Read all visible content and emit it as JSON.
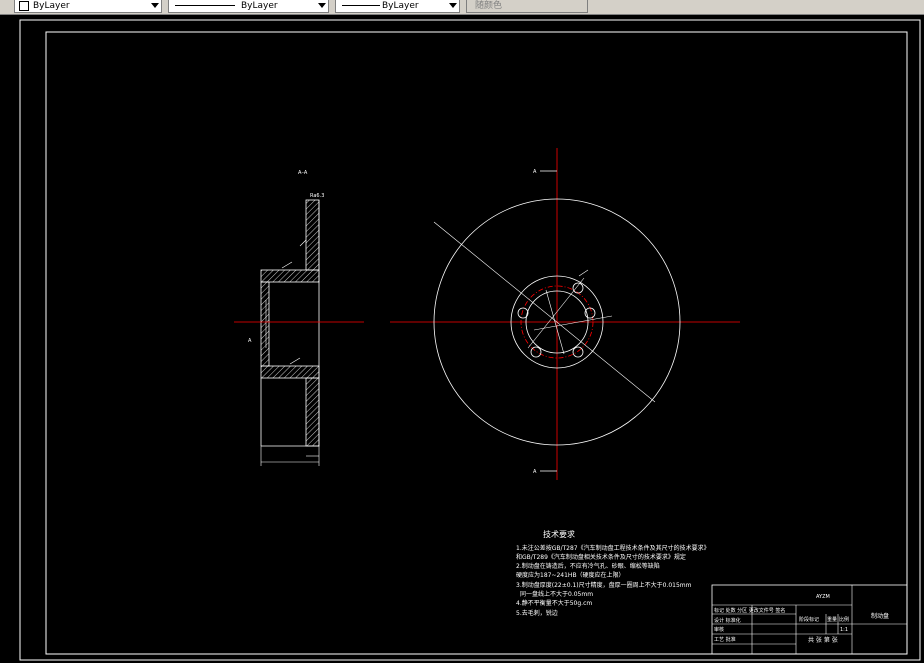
{
  "toolbar": {
    "color_combo": "ByLayer",
    "linetype_combo": "ByLayer",
    "lineweight_combo": "ByLayer",
    "plotstyle_combo": "随颜色"
  },
  "drawing": {
    "section_label": "A–A",
    "roughness_top": "Ra6.3",
    "view_marker_top": "A",
    "view_marker_bottom": "A",
    "view_marker_left": "A",
    "tech_title": "技术要求",
    "tech_notes": [
      "1.未注公差按GB/T287《汽车制动盘工程技术条件及其尺寸的技术要求》",
      "和GB/T289《汽车制动盘相关技术条件及尺寸的技术要求》规定",
      "2.制动盘在铸造后，不应有冷气孔、砂眼、缩松等缺陷",
      "硬度应为187~241HB（硬度应在上限）",
      "3.制动盘厚度(22±0.1)尺寸精度，盘厚一圈周上不大于0.015mm",
      "同一盘线上不大于0.05mm",
      "4.静不平衡量不大于50g.cm",
      "5.去毛刺，锐边"
    ],
    "title_block": {
      "drawing_no": "AYZM",
      "part_name": "制动盘",
      "row1": "标记 处数 分区 更改文件号 签名",
      "row2": "设计 标准化",
      "row3": "审核",
      "row4": "工艺 批准",
      "stage_label": "阶段标记",
      "weight_label": "重量",
      "scale_label": "比例",
      "scale_value": "1:1",
      "sheet_label": "共 张 第 张"
    }
  },
  "colors": {
    "background": "#000000",
    "lines": "#ffffff",
    "center_lines": "#ff0000",
    "toolbar": "#d4d0c8"
  }
}
